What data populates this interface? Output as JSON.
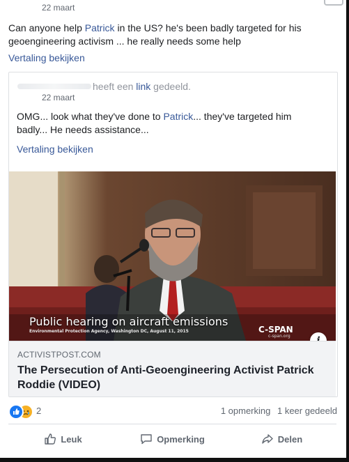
{
  "post": {
    "date": "22 maart",
    "text_before": "Can anyone help ",
    "mention": "Patrick",
    "text_after": " in the US? he's been badly targeted for his geoengineering activism ... he really needs some help",
    "translate_label": "Vertaling bekijken"
  },
  "shared": {
    "header_text": "heeft een ",
    "header_link": "link",
    "header_suffix": " gedeeld.",
    "date": "22 maart",
    "text_before": "OMG... look what they've done to ",
    "mention": "Patrick",
    "text_after": "... they've targeted him badly... He needs assistance...",
    "translate_label": "Vertaling bekijken",
    "media": {
      "caption_main": "Public hearing on aircraft emissions",
      "caption_sub": "Environmental Protection Agency, Washington DC, August 11, 2015",
      "network_logo": "C-SPAN",
      "network_url": "c-span.org",
      "info_icon": "info-icon"
    },
    "link_domain": "ACTIVISTPOST.COM",
    "link_title": "The Persecution of Anti-Geoengineering Activist Patrick Roddie (VIDEO)"
  },
  "footer": {
    "reaction_icons": [
      "like-icon",
      "sad-icon"
    ],
    "reaction_count": "2",
    "comments": "1 opmerking",
    "shares": "1 keer gedeeld",
    "actions": {
      "like": "Leuk",
      "comment": "Opmerking",
      "share": "Delen"
    }
  },
  "colors": {
    "link_blue": "#385898",
    "like_blue": "#1877f2",
    "sad_yellow": "#f7b125",
    "muted": "#606770"
  }
}
